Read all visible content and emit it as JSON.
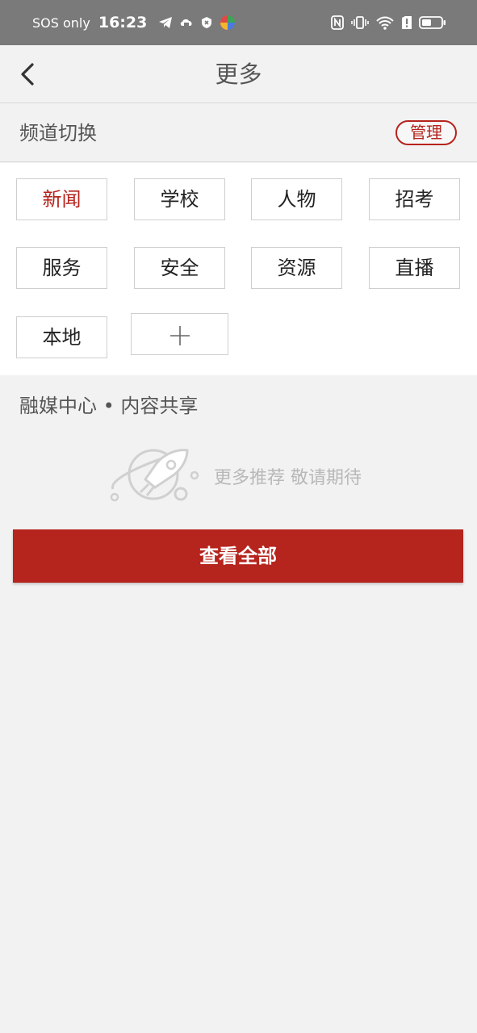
{
  "status_bar": {
    "carrier": "SOS only",
    "time": "16:23"
  },
  "nav": {
    "title": "更多"
  },
  "channel_section": {
    "label": "频道切换",
    "manage_label": "管理"
  },
  "channels": [
    {
      "label": "新闻",
      "active": true
    },
    {
      "label": "学校",
      "active": false
    },
    {
      "label": "人物",
      "active": false
    },
    {
      "label": "招考",
      "active": false
    },
    {
      "label": "服务",
      "active": false
    },
    {
      "label": "安全",
      "active": false
    },
    {
      "label": "资源",
      "active": false
    },
    {
      "label": "直播",
      "active": false
    },
    {
      "label": "本地",
      "active": false
    }
  ],
  "media_section": {
    "title": "融媒中心 • 内容共享",
    "empty_text": "更多推荐 敬请期待",
    "view_all_label": "查看全部"
  },
  "colors": {
    "accent": "#b5241d",
    "status_bar_bg": "#7a7a7a",
    "page_bg": "#f2f2f2"
  }
}
